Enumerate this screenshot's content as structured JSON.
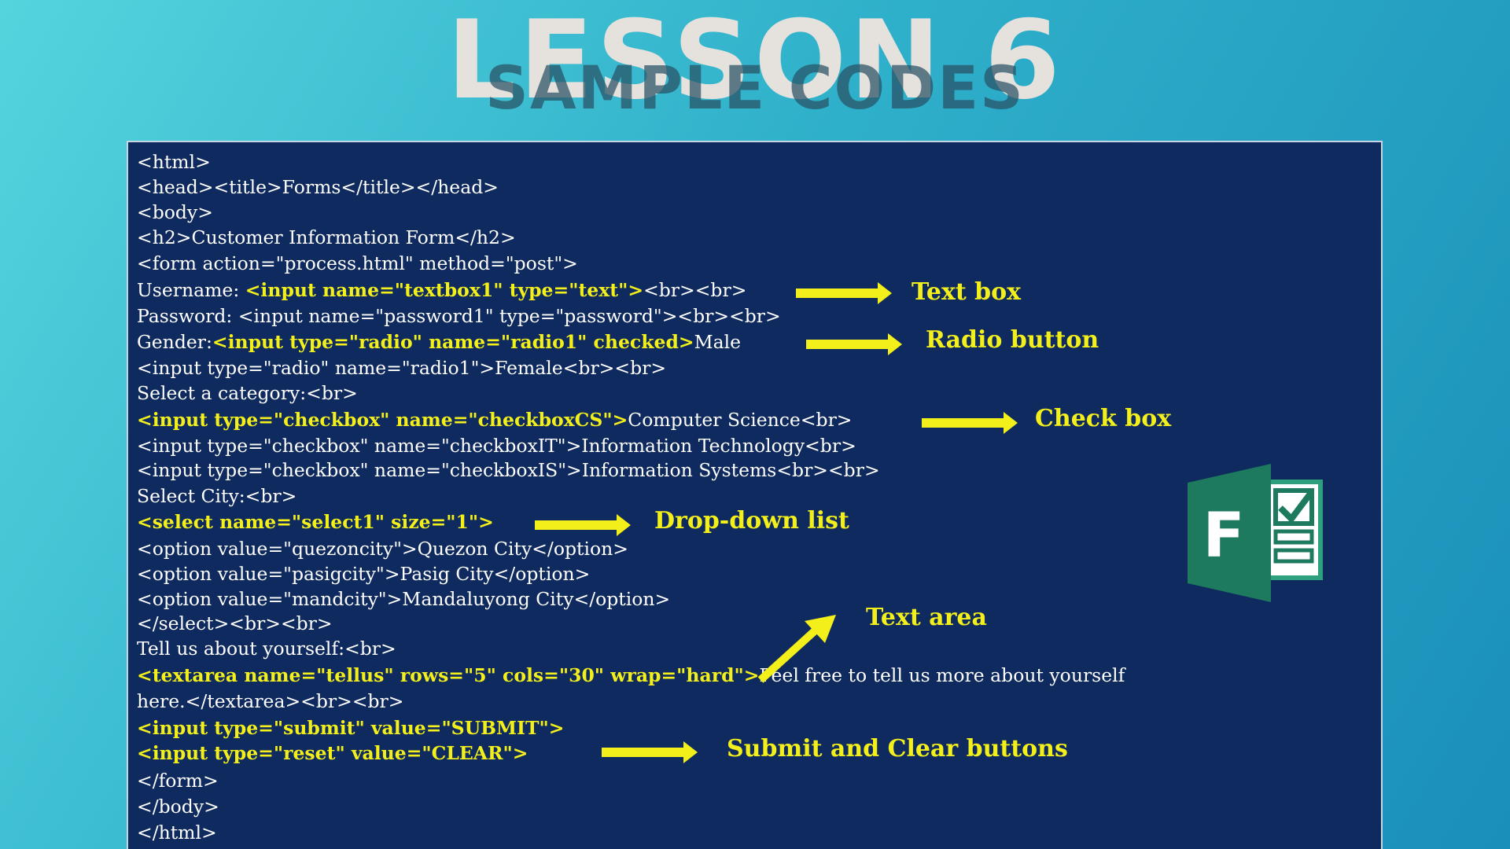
{
  "title": "LESSON 6",
  "subtitle": "SAMPLE CODES",
  "code": {
    "l01": "<html>",
    "l02": "<head><title>Forms</title></head>",
    "l03": "<body>",
    "l04": "<h2>Customer Information Form</h2>",
    "l05": "<form action=\"process.html\" method=\"post\">",
    "l06a": "Username: ",
    "l06b": "<input name=\"textbox1\" type=\"text\">",
    "l06c": "<br><br>",
    "l07": "Password: <input name=\"password1\" type=\"password\"><br><br>",
    "l08a": "Gender:",
    "l08b": "<input type=\"radio\" name=\"radio1\" checked>",
    "l08c": "Male",
    "l09": "<input type=\"radio\" name=\"radio1\">Female<br><br>",
    "l10": "Select a category:<br>",
    "l11a": "<input type=\"checkbox\" name=\"checkboxCS\">",
    "l11b": "Computer Science<br>",
    "l12": "<input type=\"checkbox\" name=\"checkboxIT\">Information Technology<br>",
    "l13": "<input type=\"checkbox\" name=\"checkboxIS\">Information Systems<br><br>",
    "l14": "Select City:<br>",
    "l15": "<select name=\"select1\" size=\"1\">",
    "l16": "<option value=\"quezoncity\">Quezon City</option>",
    "l17": "<option value=\"pasigcity\">Pasig City</option>",
    "l18": "<option value=\"mandcity\">Mandaluyong City</option>",
    "l19": "</select><br><br>",
    "l20": "Tell us about yourself:<br>",
    "l21a": "<textarea name=\"tellus\" rows=\"5\" cols=\"30\" wrap=\"hard\">",
    "l21b": "Feel free to tell us more about yourself",
    "l22": "here.</textarea><br><br>",
    "l23": "<input type=\"submit\" value=\"SUBMIT\">",
    "l24": "<input type=\"reset\" value=\"CLEAR\">",
    "l25": "</form>",
    "l26": "</body>",
    "l27": "</html>"
  },
  "callouts": {
    "text_box": "Text box",
    "radio_button": "Radio button",
    "check_box": "Check box",
    "dropdown_list": "Drop-down list",
    "text_area": "Text area",
    "submit_clear": "Submit and Clear buttons"
  },
  "icon": {
    "name": "microsoft-forms-icon",
    "letter": "F"
  },
  "colors": {
    "panel_bg": "#0f2a5e",
    "highlight": "#f3ef1b",
    "forms_green": "#1e7a5f"
  }
}
